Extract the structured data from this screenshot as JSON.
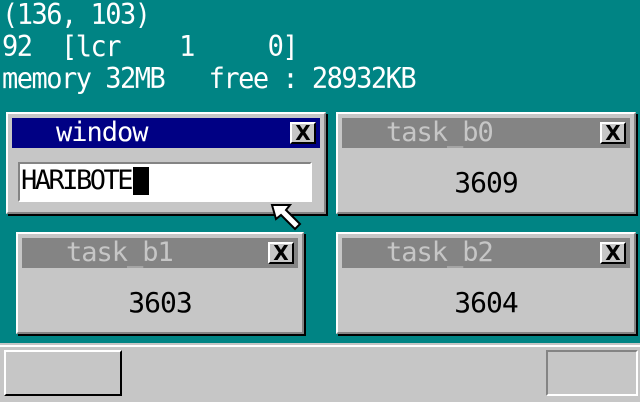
{
  "debug": {
    "mouse_coords": "(136, 103)",
    "mouse_status": "92  [lcr    1     0]",
    "memory_info": "memory 32MB   free : 28932KB"
  },
  "windows": {
    "console": {
      "title": "window",
      "input_value": "HARIBOTE",
      "close_label": "X"
    },
    "task_b0": {
      "title": "task_b0",
      "counter": "3609",
      "close_label": "X"
    },
    "task_b1": {
      "title": "task_b1",
      "counter": "3603",
      "close_label": "X"
    },
    "task_b2": {
      "title": "task_b2",
      "counter": "3604",
      "close_label": "X"
    }
  },
  "colors": {
    "desktop": "#008484",
    "window_face": "#c6c6c6",
    "active_title": "#000084",
    "inactive_title": "#848484"
  },
  "icons": {
    "mouse": "mouse-cursor-icon",
    "close": "close-icon"
  }
}
